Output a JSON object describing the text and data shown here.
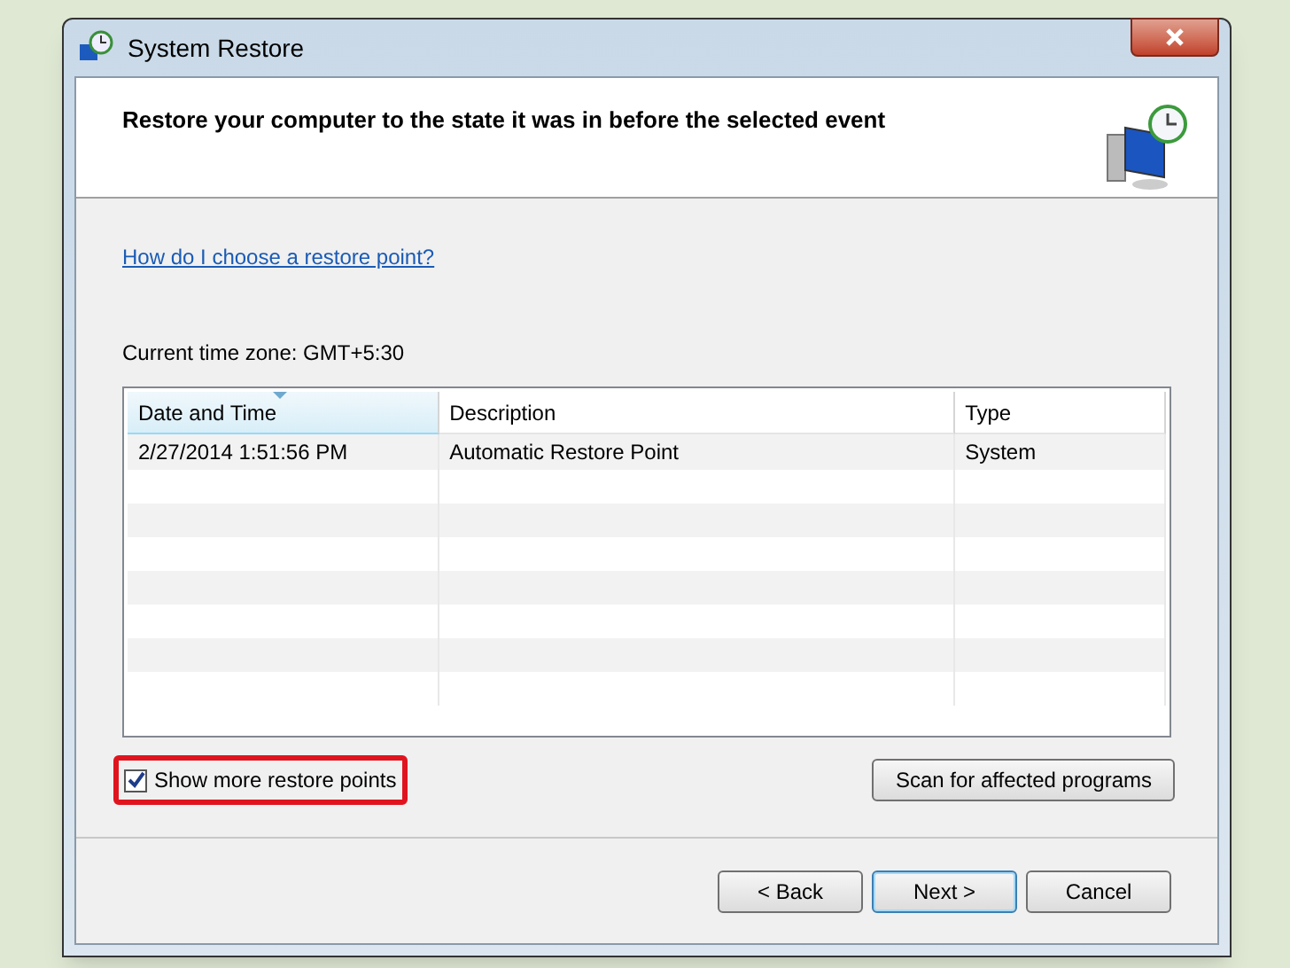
{
  "window": {
    "title": "System Restore"
  },
  "header": {
    "heading": "Restore your computer to the state it was in before the selected event"
  },
  "help_link": "How do I choose a restore point?",
  "time_zone": "Current time zone: GMT+5:30",
  "table": {
    "columns": [
      {
        "label": "Date and Time",
        "sorted": true
      },
      {
        "label": "Description",
        "sorted": false
      },
      {
        "label": "Type",
        "sorted": false
      }
    ],
    "rows": [
      {
        "cells": [
          "2/27/2014 1:51:56 PM",
          "Automatic Restore Point",
          "System"
        ],
        "selected": false
      }
    ]
  },
  "show_more": {
    "label": "Show more restore points",
    "checked": true,
    "highlighted": true
  },
  "scan_button": "Scan for affected programs",
  "buttons": [
    {
      "label": "< Back",
      "default": false
    },
    {
      "label": "Next >",
      "default": true
    },
    {
      "label": "Cancel",
      "default": false
    }
  ]
}
